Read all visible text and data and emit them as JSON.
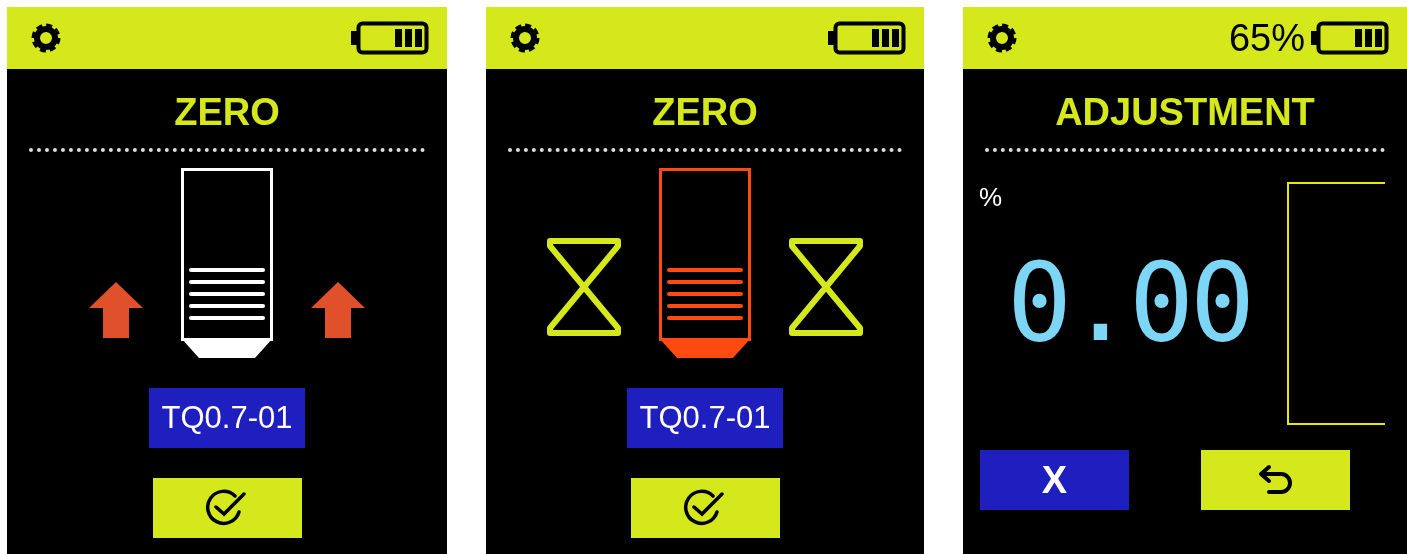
{
  "screens": [
    {
      "kind": "zero",
      "title": "ZERO",
      "measuring": false,
      "tool_label": "TQ0.7-01",
      "buttons": [
        {
          "kind": "confirm"
        }
      ]
    },
    {
      "kind": "zero",
      "title": "ZERO",
      "measuring": true,
      "tool_label": "TQ0.7-01",
      "buttons": [
        {
          "kind": "confirm"
        }
      ]
    },
    {
      "kind": "adjustment",
      "header": {
        "battery_percent": "65%"
      },
      "title": "ADJUSTMENT",
      "unit": "%",
      "reading": "0.00",
      "buttons": [
        {
          "kind": "cancel",
          "label": "X"
        },
        {
          "kind": "back"
        }
      ]
    }
  ]
}
